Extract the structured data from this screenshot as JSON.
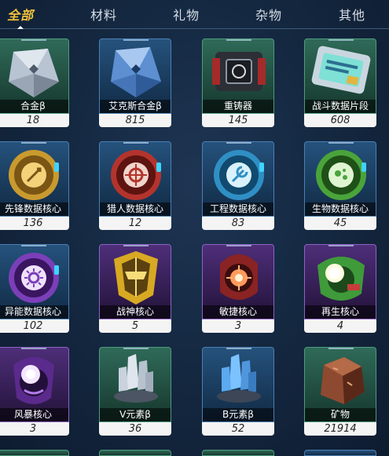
{
  "tabs": [
    {
      "label": "全部",
      "active": true
    },
    {
      "label": "材料",
      "active": false
    },
    {
      "label": "礼物",
      "active": false
    },
    {
      "label": "杂物",
      "active": false
    },
    {
      "label": "其他",
      "active": false
    }
  ],
  "colors": {
    "accent": "#f2c23a",
    "green_frame": "#4f9a7e",
    "blue_frame": "#4b7fb3",
    "purple_frame": "#8b63c4"
  },
  "items": [
    {
      "name": "合金β",
      "count": "18",
      "rarity": "green",
      "icon": "alloy-crystal-icon"
    },
    {
      "name": "艾克斯合金β",
      "count": "815",
      "rarity": "blue",
      "icon": "blue-alloy-crystal-icon"
    },
    {
      "name": "重铸器",
      "count": "145",
      "rarity": "green",
      "icon": "reforger-device-icon"
    },
    {
      "name": "战斗数据片段",
      "count": "608",
      "rarity": "green",
      "icon": "data-chip-icon"
    },
    {
      "name": "先锋数据核心",
      "count": "136",
      "rarity": "blue",
      "icon": "vanguard-core-icon"
    },
    {
      "name": "猎人数据核心",
      "count": "12",
      "rarity": "blue",
      "icon": "hunter-core-icon"
    },
    {
      "name": "工程数据核心",
      "count": "83",
      "rarity": "blue",
      "icon": "engineering-core-icon"
    },
    {
      "name": "生物数据核心",
      "count": "45",
      "rarity": "blue",
      "icon": "bio-core-icon"
    },
    {
      "name": "异能数据核心",
      "count": "102",
      "rarity": "blue",
      "icon": "psionic-core-icon"
    },
    {
      "name": "战神核心",
      "count": "5",
      "rarity": "purple",
      "icon": "war-god-core-icon"
    },
    {
      "name": "敏捷核心",
      "count": "3",
      "rarity": "purple",
      "icon": "agility-core-icon"
    },
    {
      "name": "再生核心",
      "count": "4",
      "rarity": "purple",
      "icon": "regen-core-icon"
    },
    {
      "name": "风暴核心",
      "count": "3",
      "rarity": "purple",
      "icon": "storm-core-icon"
    },
    {
      "name": "V元素β",
      "count": "36",
      "rarity": "green",
      "icon": "v-element-crystal-icon"
    },
    {
      "name": "B元素β",
      "count": "52",
      "rarity": "blue",
      "icon": "b-element-crystal-icon"
    },
    {
      "name": "矿物",
      "count": "21914",
      "rarity": "green",
      "icon": "mineral-ore-icon"
    }
  ]
}
